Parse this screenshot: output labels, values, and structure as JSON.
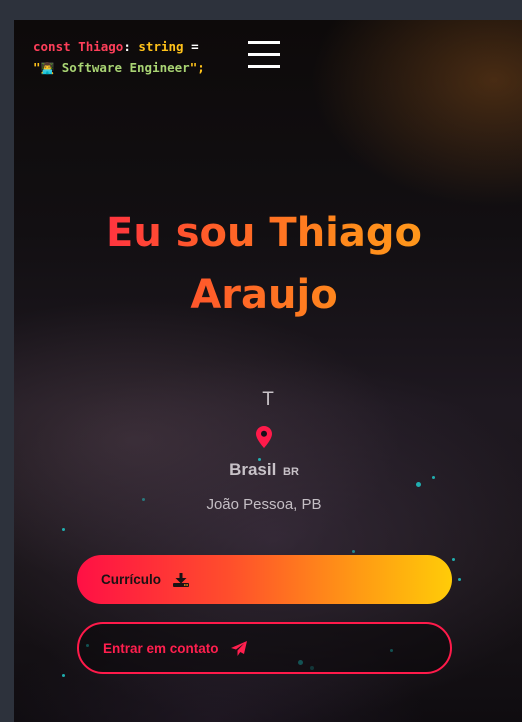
{
  "header": {
    "logo": {
      "keyword": "const",
      "name": "Thiago",
      "colon": ":",
      "type": "string",
      "equals": "=",
      "quote_open": "\"",
      "emoji": "👨‍💻",
      "role": "Software Engineer",
      "quote_close": "\";"
    },
    "menu_icon": "hamburger-icon"
  },
  "hero": {
    "title": "Eu sou Thiago Araujo",
    "typing_text": "T",
    "location_icon": "map-pin-icon",
    "country": "Brasil",
    "country_code": "BR",
    "city": "João Pessoa, PB"
  },
  "actions": {
    "resume_label": "Currículo",
    "resume_icon": "download-icon",
    "contact_label": "Entrar em contato",
    "contact_icon": "paper-plane-icon"
  },
  "colors": {
    "accent_red": "#ff1a4a",
    "accent_orange": "#ff8a1c",
    "accent_yellow": "#ffcc08",
    "background": "#0f0c10"
  }
}
